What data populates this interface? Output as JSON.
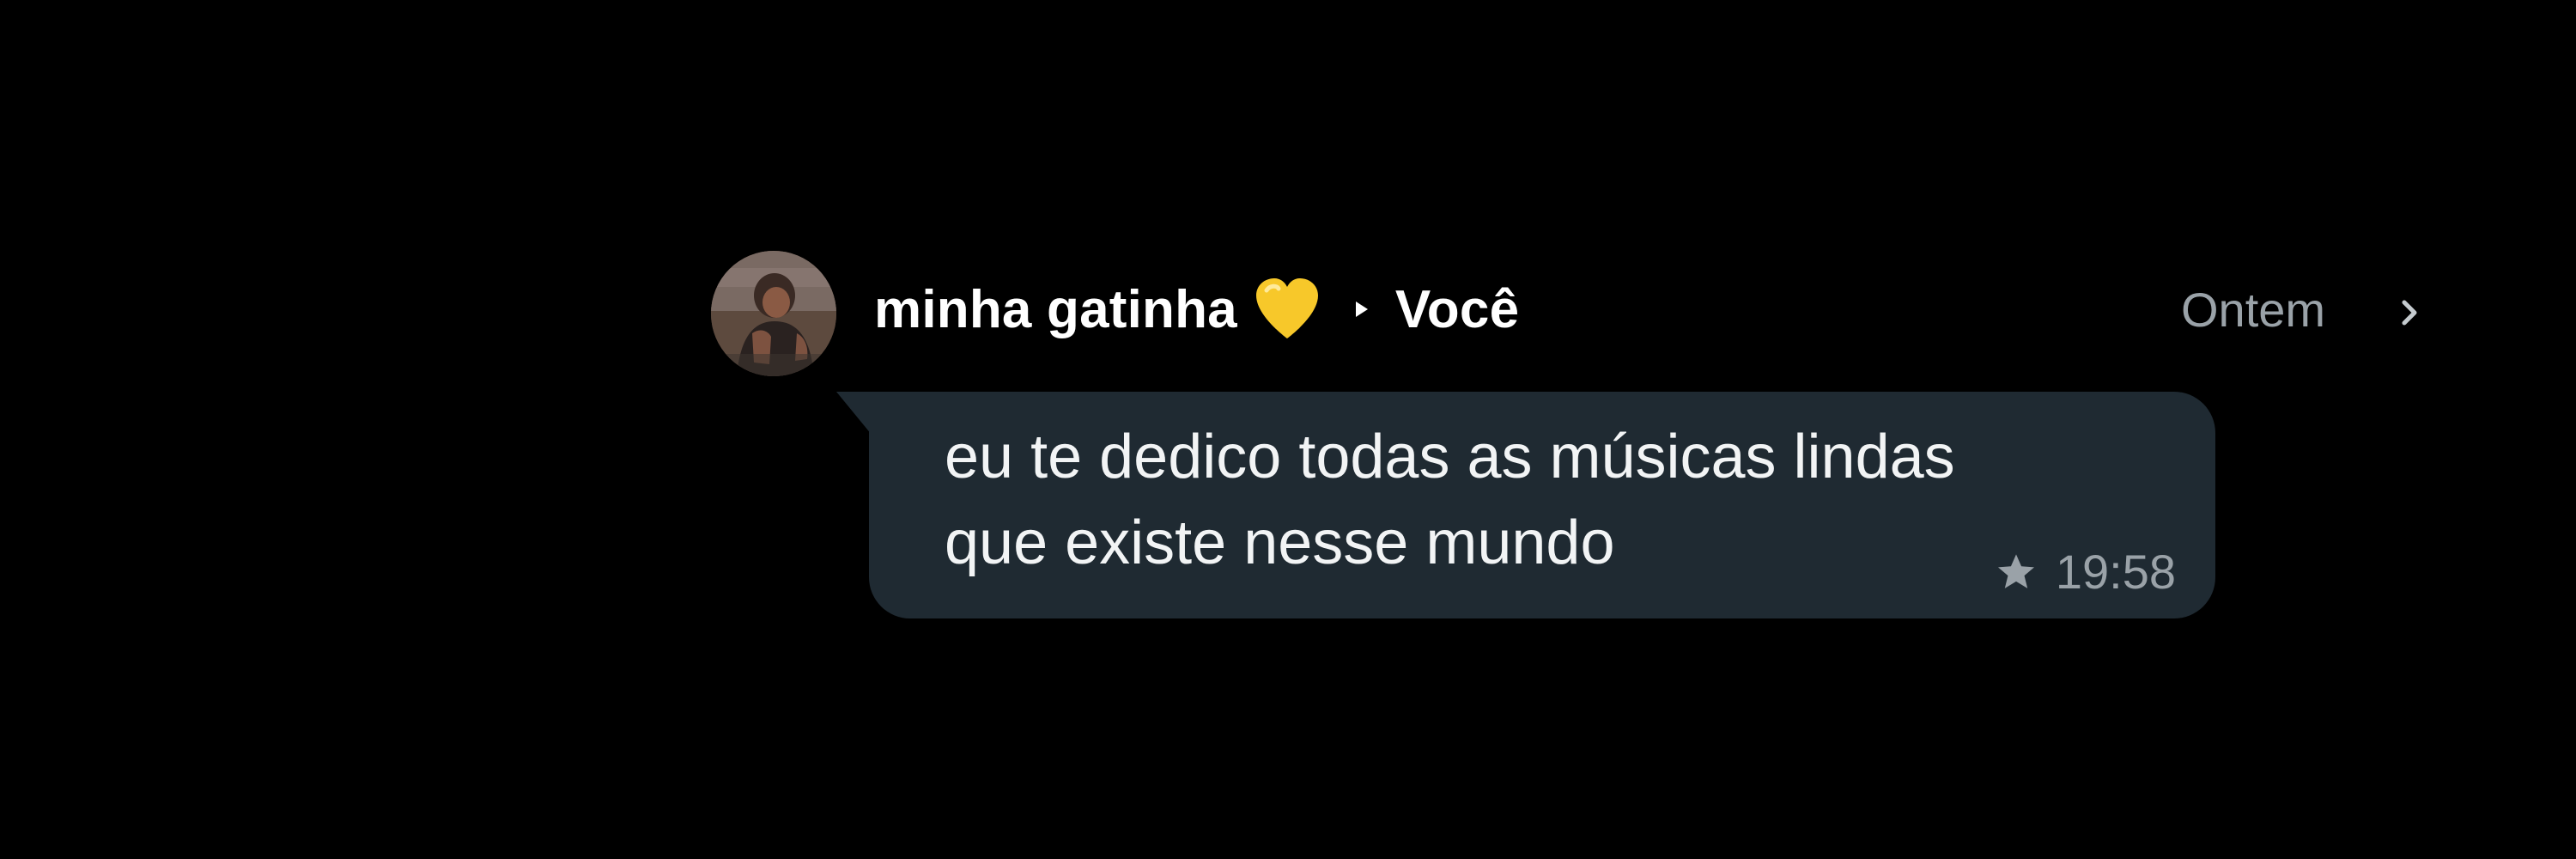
{
  "message": {
    "sender": "minha gatinha",
    "sender_emoji": "yellow-heart-icon",
    "recipient": "Você",
    "date": "Ontem",
    "text": "eu te dedico todas as músicas lindas\nque existe nesse mundo",
    "time": "19:58",
    "starred": true
  },
  "icons": {
    "avatar": "avatar-photo",
    "heart": "yellow-heart-icon",
    "direction": "play-arrow-icon",
    "star": "star-icon",
    "chevron": "chevron-right-icon"
  },
  "colors": {
    "background": "#000000",
    "bubble": "#1f2a32",
    "text": "#f2f4f5",
    "muted": "#9aa2a8",
    "heart": "#f7c82a"
  }
}
